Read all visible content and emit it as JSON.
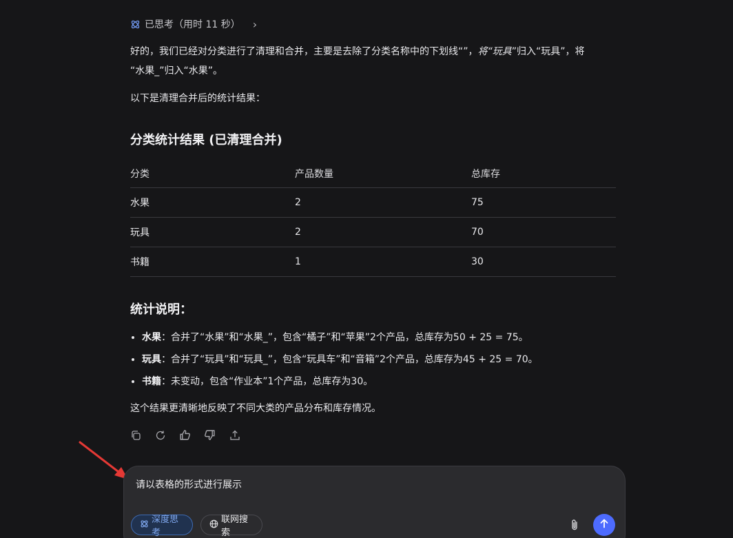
{
  "thought": {
    "label": "已思考（用时 11 秒）",
    "chevron": "›"
  },
  "intro": {
    "line1_a": "好的，我们已经对分类进行了清理和合并，主要是去除了分类名称中的下划线“”，",
    "line1_em": "将“玩具",
    "line1_b": "”归入“玩具”，将",
    "line2": "“水果_”归入“水果”。"
  },
  "lead": "以下是清理合并后的统计结果：",
  "section_title": "分类统计结果 (已清理合并)",
  "table": {
    "headers": [
      "分类",
      "产品数量",
      "总库存"
    ],
    "rows": [
      [
        "水果",
        "2",
        "75"
      ],
      [
        "玩具",
        "2",
        "70"
      ],
      [
        "书籍",
        "1",
        "30"
      ]
    ]
  },
  "notes_title": "统计说明：",
  "notes": [
    {
      "bold": "水果",
      "text": "：合并了“水果”和“水果_”，包含“橘子”和“苹果”2个产品，总库存为50 + 25 = 75。"
    },
    {
      "bold": "玩具",
      "text": "：合并了“玩具”和“玩具_”，包含“玩具车”和“音箱”2个产品，总库存为45 + 25 = 70。"
    },
    {
      "bold": "书籍",
      "text": "：未变动，包含“作业本”1个产品，总库存为30。"
    }
  ],
  "conclusion": "这个结果更清晰地反映了不同大类的产品分布和库存情况。",
  "actions": [
    "copy-icon",
    "regenerate-icon",
    "thumbs-up-icon",
    "thumbs-down-icon",
    "share-icon"
  ],
  "composer": {
    "text": "请以表格的形式进行展示",
    "deep_think": "深度思考",
    "web_search": "联网搜索"
  },
  "colors": {
    "accent": "#4d6bfe",
    "annotation_arrow": "#e53935",
    "background": "#161618"
  }
}
